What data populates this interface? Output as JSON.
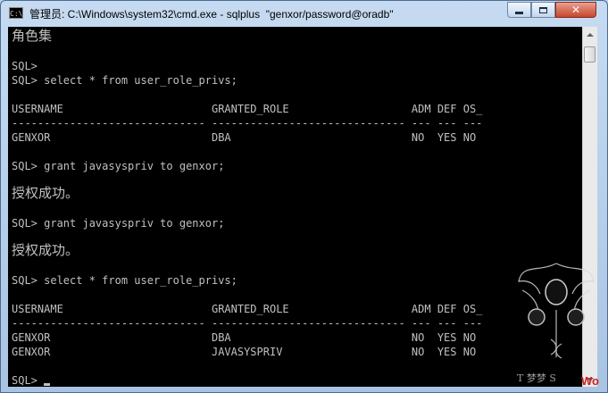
{
  "window": {
    "title": "管理员: C:\\Windows\\system32\\cmd.exe - sqlplus  \"genxor/password@oradb\"",
    "icon_text": "C:\\",
    "close_glyph": "✕"
  },
  "console": {
    "lines": [
      "角色集",
      "",
      "SQL>",
      "SQL> select * from user_role_privs;",
      "",
      "USERNAME                       GRANTED_ROLE                   ADM DEF OS_",
      "------------------------------ ------------------------------ --- --- ---",
      "GENXOR                         DBA                            NO  YES NO",
      "",
      "SQL> grant javasyspriv to genxor;",
      "",
      "授权成功。",
      "",
      "SQL> grant javasyspriv to genxor;",
      "",
      "授权成功。",
      "",
      "SQL> select * from user_role_privs;",
      "",
      "USERNAME                       GRANTED_ROLE                   ADM DEF OS_",
      "------------------------------ ------------------------------ --- --- ---",
      "GENXOR                         DBA                            NO  YES NO",
      "GENXOR                         JAVASYSPRIV                    NO  YES NO",
      "",
      "SQL> "
    ]
  },
  "watermark": {
    "text": "Wo"
  },
  "colors": {
    "console_bg": "#000000",
    "console_fg": "#c0c0c0",
    "watermark": "#cc2222"
  }
}
